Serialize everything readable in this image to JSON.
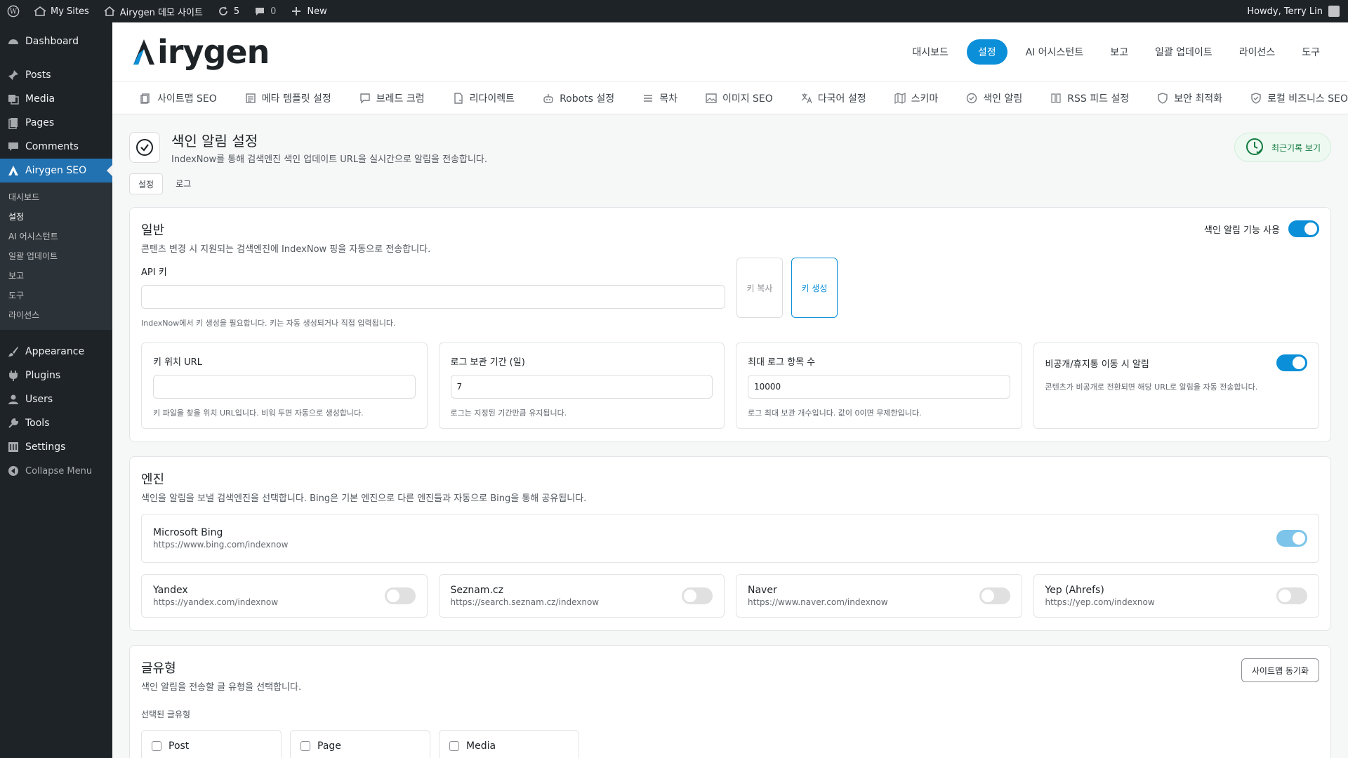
{
  "adminbar": {
    "my_sites": "My Sites",
    "site_name": "Airygen 데모 사이트",
    "updates_count": "5",
    "comments_count": "0",
    "new_label": "New",
    "howdy": "Howdy, Terry Lin"
  },
  "sidebar": {
    "dashboard": "Dashboard",
    "posts": "Posts",
    "media": "Media",
    "pages": "Pages",
    "comments": "Comments",
    "airygen": "Airygen SEO",
    "sub": [
      "대시보드",
      "설정",
      "AI 어시스턴트",
      "일괄 업데이트",
      "보고",
      "도구",
      "라이선스"
    ],
    "appearance": "Appearance",
    "plugins": "Plugins",
    "users": "Users",
    "tools": "Tools",
    "settings": "Settings",
    "collapse": "Collapse Menu"
  },
  "logo": {
    "text": "irygen"
  },
  "topnav": [
    "대시보드",
    "설정",
    "AI 어시스턴트",
    "보고",
    "일괄 업데이트",
    "라이선스",
    "도구"
  ],
  "subnav": [
    "사이트맵 SEO",
    "메타 템플릿 설정",
    "브레드 크럼",
    "리다이렉트",
    "Robots 설정",
    "목차",
    "이미지 SEO",
    "다국어 설정",
    "스키마",
    "색인 알림",
    "RSS 피드 설정",
    "보안 최적화",
    "로컬 비즈니스 SEO",
    "..."
  ],
  "page": {
    "title": "색인 알림 설정",
    "desc": "IndexNow를 통해 검색엔진 색인 업데이트 URL을 실시간으로 알림을 전송합니다.",
    "history": "최근기록 보기"
  },
  "tabs": [
    "설정",
    "로그"
  ],
  "general": {
    "title": "일반",
    "desc": "콘텐츠 변경 시 지원되는 검색엔진에 IndexNow 핑을 자동으로 전송합니다.",
    "toggle_label": "색인 알림 기능 사용",
    "api_label": "API 키",
    "api_value": "",
    "api_hint": "IndexNow에서 키 생성을 필요합니다. 키는 자동 생성되거나 직접 입력됩니다.",
    "btn_copy": "키 복사",
    "btn_generate": "키 생성",
    "key_url_label": "키 위치 URL",
    "key_url_value": "",
    "key_url_hint": "키 파일을 찾을 위치 URL입니다. 비워 두면 자동으로 생성합니다.",
    "log_days_label": "로그 보관 기간 (일)",
    "log_days_value": "7",
    "log_days_hint": "로그는 지정된 기간만큼 유지됩니다.",
    "max_label": "최대 로그 항목 수",
    "max_value": "10000",
    "max_hint": "로그 최대 보관 개수입니다. 값이 0이면 무제한입니다.",
    "unpublish_label": "비공개/휴지통 이동 시 알림",
    "unpublish_hint": "콘텐츠가 비공개로 전환되면 해당 URL로 알림을 자동 전송합니다."
  },
  "engines": {
    "title": "엔진",
    "desc": "색인을 알림을 보낼 검색엔진을 선택합니다. Bing은 기본 엔진으로 다른 엔진들과 자동으로 Bing을 통해 공유됩니다.",
    "list": [
      {
        "name": "Microsoft Bing",
        "url": "https://www.bing.com/indexnow"
      },
      {
        "name": "Yandex",
        "url": "https://yandex.com/indexnow"
      },
      {
        "name": "Seznam.cz",
        "url": "https://search.seznam.cz/indexnow"
      },
      {
        "name": "Naver",
        "url": "https://www.naver.com/indexnow"
      },
      {
        "name": "Yep (Ahrefs)",
        "url": "https://yep.com/indexnow"
      }
    ]
  },
  "post_types": {
    "title": "글유형",
    "desc": "색인 알림을 전송할 글 유형을 선택합니다.",
    "btn": "사이트맵 동기화",
    "label": "선택된 글유형",
    "items": [
      "Post",
      "Page",
      "Media"
    ]
  },
  "colors": {
    "accent": "#0b8fd8",
    "admin_dark": "#1d2327",
    "active_menu": "#2271b1",
    "success": "#117a3e"
  }
}
